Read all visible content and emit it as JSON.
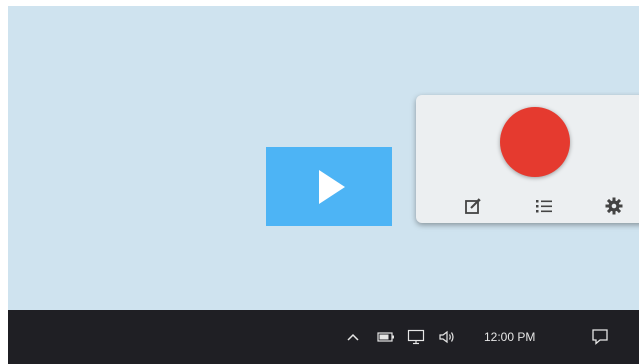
{
  "desktop": {
    "background_color": "#cfe3ef"
  },
  "video_thumbnail": {
    "icon": "play-icon",
    "color": "#4db4f5"
  },
  "recorder": {
    "record_button": {
      "icon": "record-icon",
      "color": "#e53a2f"
    },
    "tools": [
      {
        "icon": "edit-icon"
      },
      {
        "icon": "list-icon"
      },
      {
        "icon": "gear-icon"
      }
    ]
  },
  "taskbar": {
    "tray_icons": [
      "chevron-up-icon",
      "battery-icon",
      "network-icon",
      "volume-icon"
    ],
    "clock": "12:00 PM",
    "notification_icon": "action-center-icon"
  }
}
